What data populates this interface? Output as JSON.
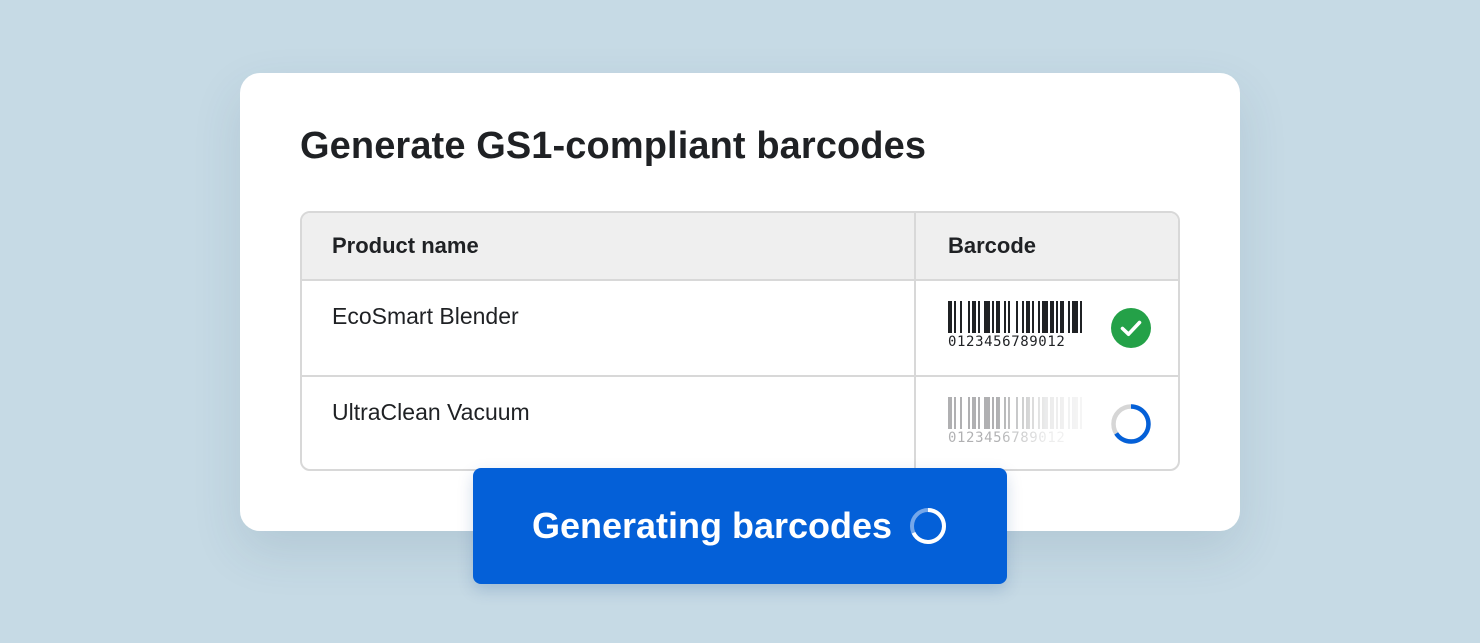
{
  "card": {
    "title": "Generate GS1-compliant barcodes"
  },
  "table": {
    "headers": {
      "product": "Product name",
      "barcode": "Barcode"
    },
    "rows": [
      {
        "product_name": "EcoSmart Blender",
        "barcode_digits": "0123456789012",
        "status": "complete",
        "status_icon": "check-circle-icon"
      },
      {
        "product_name": "UltraClean Vacuum",
        "barcode_digits": "0123456789012",
        "status": "generating",
        "status_icon": "spinner-icon"
      }
    ]
  },
  "action": {
    "label": "Generating barcodes",
    "icon": "spinner-icon"
  },
  "colors": {
    "background": "#c6dae5",
    "accent": "#0460d8",
    "success": "#24a148",
    "spinner_track": "#d6d6d6"
  }
}
